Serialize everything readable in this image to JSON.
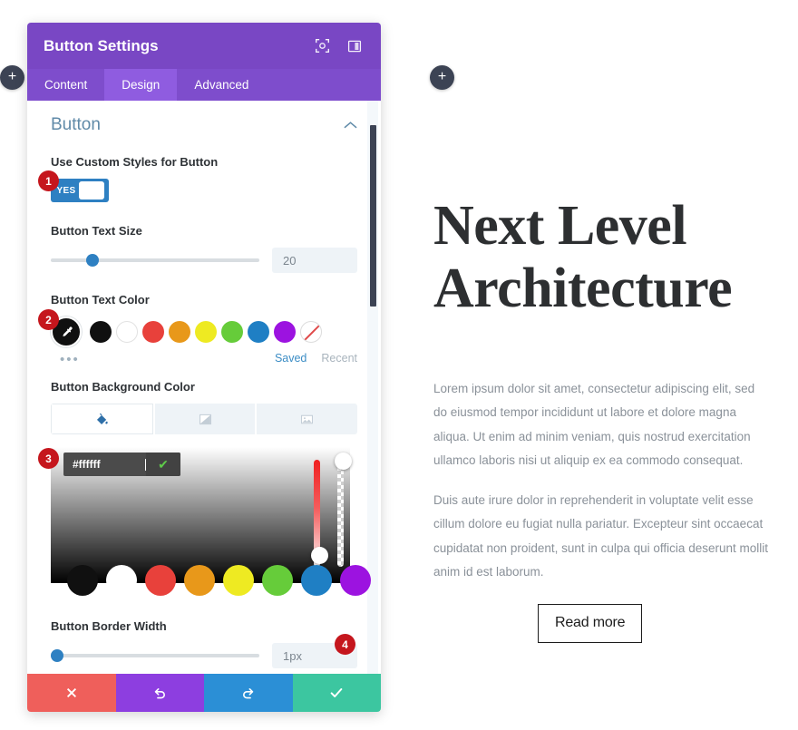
{
  "canvas": {
    "add_buttons": [
      {
        "name": "add-module-left",
        "label": "+"
      },
      {
        "name": "add-module-right",
        "label": "+"
      }
    ]
  },
  "modal": {
    "title": "Button Settings",
    "header_icons": [
      {
        "name": "focus-target-icon"
      },
      {
        "name": "layout-panel-icon"
      }
    ],
    "tabs": [
      {
        "label": "Content",
        "active": false
      },
      {
        "label": "Design",
        "active": true
      },
      {
        "label": "Advanced",
        "active": false
      }
    ],
    "section": {
      "title": "Button",
      "collapse_icon": "chevron-up-icon"
    },
    "fields": {
      "custom_styles": {
        "label": "Use Custom Styles for Button",
        "toggle_value": "YES"
      },
      "text_size": {
        "label": "Button Text Size",
        "value": "20",
        "slider_percent": 20
      },
      "text_color": {
        "label": "Button Text Color",
        "selected_color": "#000000",
        "picker_icon": "eyedropper-icon",
        "more_icon": "ellipsis-icon",
        "swatches": [
          {
            "name": "swatch-black",
            "color": "#101010"
          },
          {
            "name": "swatch-white",
            "color": "#ffffff"
          },
          {
            "name": "swatch-red",
            "color": "#e8413b"
          },
          {
            "name": "swatch-orange",
            "color": "#e8981a"
          },
          {
            "name": "swatch-yellow",
            "color": "#eeea22"
          },
          {
            "name": "swatch-green",
            "color": "#66cc3a"
          },
          {
            "name": "swatch-blue",
            "color": "#1f7fc4"
          },
          {
            "name": "swatch-purple",
            "color": "#9c13e0"
          },
          {
            "name": "swatch-transparent",
            "color": "transparent"
          }
        ],
        "saved_label": "Saved",
        "recent_label": "Recent"
      },
      "background_color": {
        "label": "Button Background Color",
        "type_tabs": [
          {
            "name": "bg-tab-solid",
            "icon": "paint-bucket-icon",
            "active": true
          },
          {
            "name": "bg-tab-gradient",
            "icon": "gradient-icon",
            "active": false
          },
          {
            "name": "bg-tab-image",
            "icon": "image-icon",
            "active": false
          }
        ],
        "hex_value": "#ffffff",
        "confirm_icon": "checkmark-icon",
        "presets": [
          {
            "name": "preset-black",
            "color": "#101010"
          },
          {
            "name": "preset-white",
            "color": "#ffffff"
          },
          {
            "name": "preset-red",
            "color": "#e8413b"
          },
          {
            "name": "preset-orange",
            "color": "#e8981a"
          },
          {
            "name": "preset-yellow",
            "color": "#eeea22"
          },
          {
            "name": "preset-green",
            "color": "#66cc3a"
          },
          {
            "name": "preset-blue",
            "color": "#1f7fc4"
          },
          {
            "name": "preset-purple",
            "color": "#9c13e0"
          }
        ]
      },
      "border_width": {
        "label": "Button Border Width",
        "value": "1px",
        "slider_percent": 3
      }
    },
    "footer_buttons": [
      {
        "name": "cancel-button",
        "icon": "close-icon"
      },
      {
        "name": "undo-button",
        "icon": "undo-icon"
      },
      {
        "name": "redo-button",
        "icon": "redo-icon"
      },
      {
        "name": "save-button",
        "icon": "checkmark-icon"
      }
    ]
  },
  "step_badges": [
    {
      "number": "1"
    },
    {
      "number": "2"
    },
    {
      "number": "3"
    },
    {
      "number": "4"
    }
  ],
  "preview": {
    "heading": "Next Level Architecture",
    "paragraph_1": "Lorem ipsum dolor sit amet, consectetur adipiscing elit, sed do eiusmod tempor incididunt ut labore et dolore magna aliqua. Ut enim ad minim veniam, quis nostrud exercitation ullamco laboris nisi ut aliquip ex ea commodo consequat.",
    "paragraph_2": "Duis aute irure dolor in reprehenderit in voluptate velit esse cillum dolore eu fugiat nulla pariatur. Excepteur sint occaecat cupidatat non proident, sunt in culpa qui officia deserunt mollit anim id est laborum.",
    "button_label": "Read more"
  },
  "colors": {
    "modal_header": "#7947c4",
    "tab_active": "#8f5ce0",
    "accent_blue": "#2e80c2",
    "badge_red": "#c5161d"
  }
}
